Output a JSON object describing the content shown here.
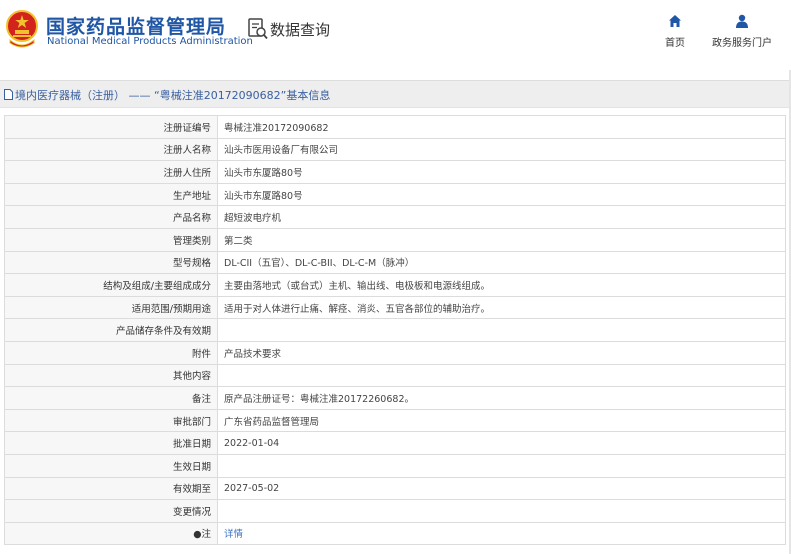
{
  "header": {
    "title_cn": "国家药品监督管理局",
    "title_en": "National Medical Products Administration",
    "data_query_label": "数据查询",
    "nav": [
      {
        "label": "首页",
        "icon": "home-icon"
      },
      {
        "label": "政务服务门户",
        "icon": "user-icon"
      }
    ]
  },
  "breadcrumb": {
    "text": "境内医疗器械（注册） —— “粤械注准20172090682”基本信息"
  },
  "table": {
    "rows": [
      {
        "label": "注册证编号",
        "value": "粤械注准20172090682"
      },
      {
        "label": "注册人名称",
        "value": "汕头市医用设备厂有限公司"
      },
      {
        "label": "注册人住所",
        "value": "汕头市东厦路80号"
      },
      {
        "label": "生产地址",
        "value": "汕头市东厦路80号"
      },
      {
        "label": "产品名称",
        "value": "超短波电疗机"
      },
      {
        "label": "管理类别",
        "value": "第二类"
      },
      {
        "label": "型号规格",
        "value": "DL-CII（五官）、DL-C-BII、DL-C-M（脉冲）"
      },
      {
        "label": "结构及组成/主要组成成分",
        "value": "主要由落地式（或台式）主机、输出线、电极板和电源线组成。"
      },
      {
        "label": "适用范围/预期用途",
        "value": "适用于对人体进行止痛、解痉、消炎、五官各部位的辅助治疗。"
      },
      {
        "label": "产品储存条件及有效期",
        "value": ""
      },
      {
        "label": "附件",
        "value": "产品技术要求"
      },
      {
        "label": "其他内容",
        "value": ""
      },
      {
        "label": "备注",
        "value": "原产品注册证号：粤械注准20172260682。"
      },
      {
        "label": "审批部门",
        "value": "广东省药品监督管理局"
      },
      {
        "label": "批准日期",
        "value": "2022-01-04"
      },
      {
        "label": "生效日期",
        "value": ""
      },
      {
        "label": "有效期至",
        "value": "2027-05-02"
      },
      {
        "label": "变更情况",
        "value": ""
      },
      {
        "label": "●注",
        "value": "详情",
        "link": true
      }
    ]
  },
  "colors": {
    "brand_blue": "#1f56a5",
    "emblem_red": "#d2231c",
    "emblem_gold": "#f2c12e",
    "link_blue": "#3a6fc4"
  }
}
